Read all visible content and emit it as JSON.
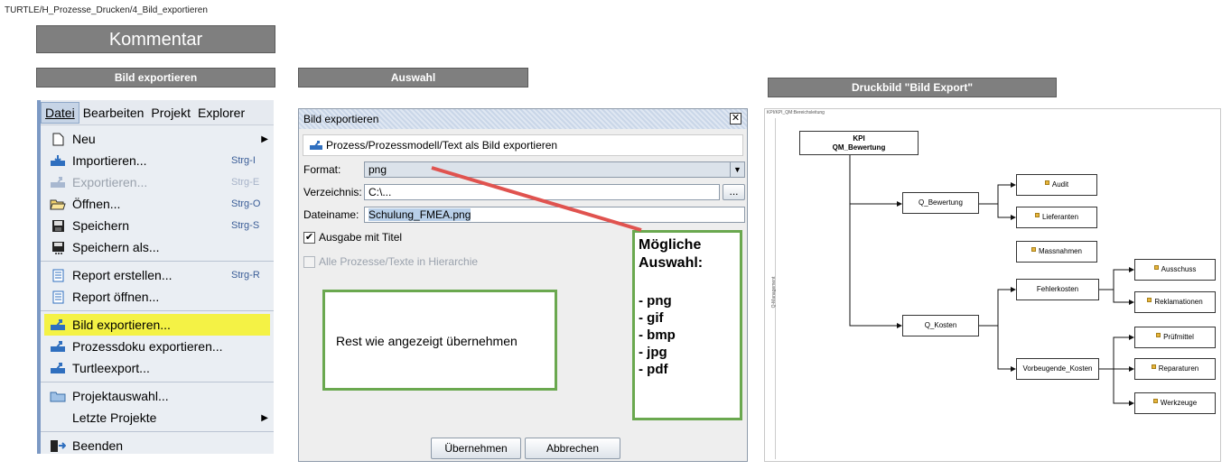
{
  "breadcrumb": "TURTLE/H_Prozesse_Drucken/4_Bild_exportieren",
  "headers": {
    "kommentar": "Kommentar",
    "bild_exportieren": "Bild exportieren",
    "auswahl": "Auswahl",
    "druckbild": "Druckbild \"Bild Export\""
  },
  "menu": {
    "bar": [
      "Datei",
      "Bearbeiten",
      "Projekt",
      "Explorer"
    ],
    "items": [
      {
        "label": "Neu",
        "shortcut": "",
        "icon": "new-file-icon",
        "submenu": true
      },
      {
        "label": "Importieren...",
        "shortcut": "Strg-I",
        "icon": "import-icon"
      },
      {
        "label": "Exportieren...",
        "shortcut": "Strg-E",
        "icon": "export-icon",
        "disabled": true
      },
      {
        "label": "Öffnen...",
        "shortcut": "Strg-O",
        "icon": "folder-open-icon"
      },
      {
        "label": "Speichern",
        "shortcut": "Strg-S",
        "icon": "save-icon"
      },
      {
        "label": "Speichern als...",
        "shortcut": "",
        "icon": "save-as-icon"
      },
      {
        "label": "Report erstellen...",
        "shortcut": "Strg-R",
        "icon": "report-icon"
      },
      {
        "label": "Report öffnen...",
        "shortcut": "",
        "icon": "report-open-icon"
      },
      {
        "label": "Bild exportieren...",
        "shortcut": "",
        "icon": "image-export-icon",
        "highlight": true
      },
      {
        "label": "Prozessdoku exportieren...",
        "shortcut": "",
        "icon": "doc-export-icon"
      },
      {
        "label": "Turtleexport...",
        "shortcut": "",
        "icon": "turtle-export-icon"
      },
      {
        "label": "Projektauswahl...",
        "shortcut": "",
        "icon": "project-folder-icon"
      },
      {
        "label": "Letzte Projekte",
        "shortcut": "",
        "icon": "",
        "submenu": true
      },
      {
        "label": "Beenden",
        "shortcut": "",
        "icon": "exit-icon"
      }
    ]
  },
  "dialog": {
    "title": "Bild exportieren",
    "subtitle": "Prozess/Prozessmodell/Text als Bild exportieren",
    "format_label": "Format:",
    "format_value": "png",
    "verzeichnis_label": "Verzeichnis:",
    "verzeichnis_value": "C:\\...",
    "browse_label": "...",
    "dateiname_label": "Dateiname:",
    "dateiname_value": "Schulung_FMEA.png",
    "ausgabe_label": "Ausgabe mit Titel",
    "alle_label": "Alle Prozesse/Texte in Hierarchie",
    "ok_label": "Übernehmen",
    "cancel_label": "Abbrechen"
  },
  "annotations": {
    "rest": "Rest wie angezeigt übernehmen",
    "moegliche_title": "Mögliche Auswahl:",
    "moegliche_items": [
      "- png",
      "- gif",
      "- bmp",
      "- jpg",
      "- pdf"
    ]
  },
  "druck": {
    "path": "KPI/KPI_QM:Bereichsleitung",
    "side_label": "Q-Management",
    "root_line1": "KPI",
    "root_line2": "QM_Bewertung",
    "nodes": {
      "q_bewertung": "Q_Bewertung",
      "audit": "Audit",
      "lieferanten": "Lieferanten",
      "massnahmen": "Massnahmen",
      "q_kosten": "Q_Kosten",
      "fehlerkosten": "Fehlerkosten",
      "ausschuss": "Ausschuss",
      "reklamationen": "Reklamationen",
      "vorbeugende": "Vorbeugende_Kosten",
      "pruefmittel": "Prüfmittel",
      "reparaturen": "Reparaturen",
      "werkzeuge": "Werkzeuge"
    }
  },
  "colors": {
    "header_bg": "#7f7f7f",
    "highlight": "#f4f245",
    "annotation_border": "#6aa84f",
    "arrow": "#e0534f"
  }
}
